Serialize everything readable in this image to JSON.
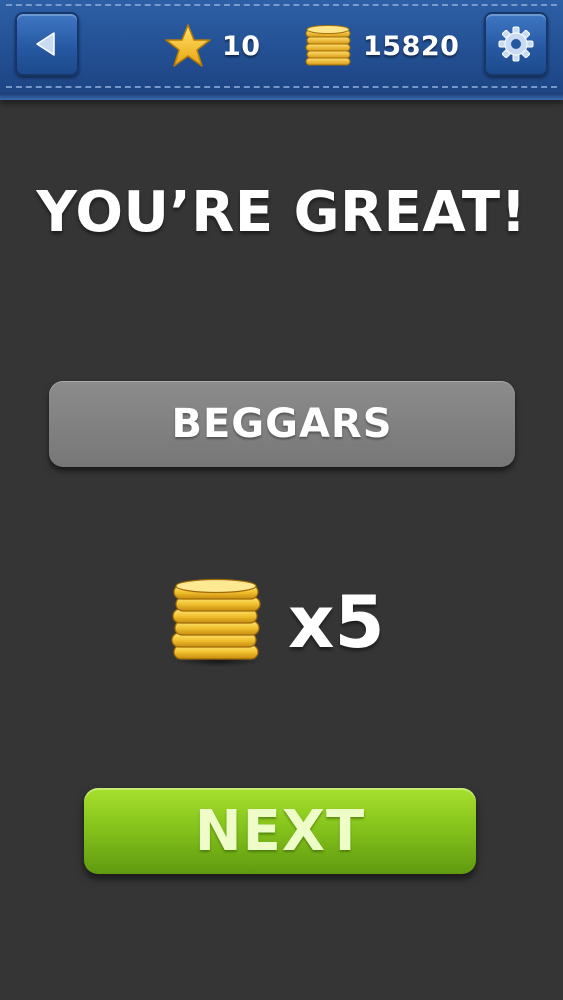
{
  "topbar": {
    "stars": "10",
    "coins": "15820",
    "icons": {
      "back": "back-arrow-icon",
      "star": "star-icon",
      "coins": "coin-stack-icon",
      "settings": "gear-icon"
    }
  },
  "result": {
    "headline": "YOU’RE GREAT!",
    "answer": "BEGGARS",
    "reward": "x5"
  },
  "actions": {
    "next_label": "NEXT"
  },
  "colors": {
    "background": "#353535",
    "topbar": "#2a5aa0",
    "answer_box": "#808080",
    "next_button": "#86c41c",
    "coin_gold": "#f2c230",
    "star_gold": "#f7c72a"
  }
}
